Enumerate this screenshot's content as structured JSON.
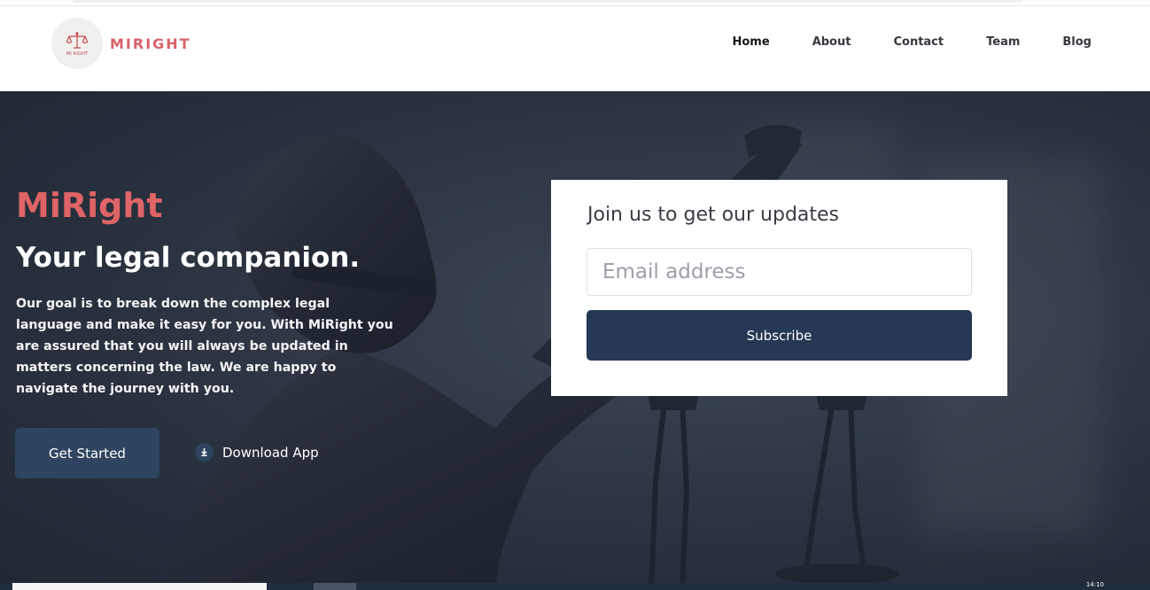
{
  "brand": {
    "logo_icon": "scales-of-justice-icon",
    "logo_caption": "MI RIGHT",
    "name": "MIRIGHT",
    "accent_color": "#d9626a"
  },
  "nav": {
    "items": [
      "Home",
      "About",
      "Contact",
      "Team",
      "Blog"
    ],
    "active": "Home"
  },
  "hero": {
    "title": "MiRight",
    "subtitle": "Your legal companion.",
    "description": "Our goal is to break down the complex legal language and make it easy for you. With MiRight you are assured that you will always be updated in matters concerning the law. We are happy to navigate the journey with you.",
    "primary_button": "Get Started",
    "download_icon": "download-icon",
    "download_label": "Download App",
    "button_color": "#2e4460"
  },
  "subscribe": {
    "heading": "Join us to get our updates",
    "email_placeholder": "Email address",
    "email_value": "",
    "button_label": "Subscribe",
    "button_color": "#253856"
  },
  "taskbar": {
    "clock": "14:10"
  }
}
